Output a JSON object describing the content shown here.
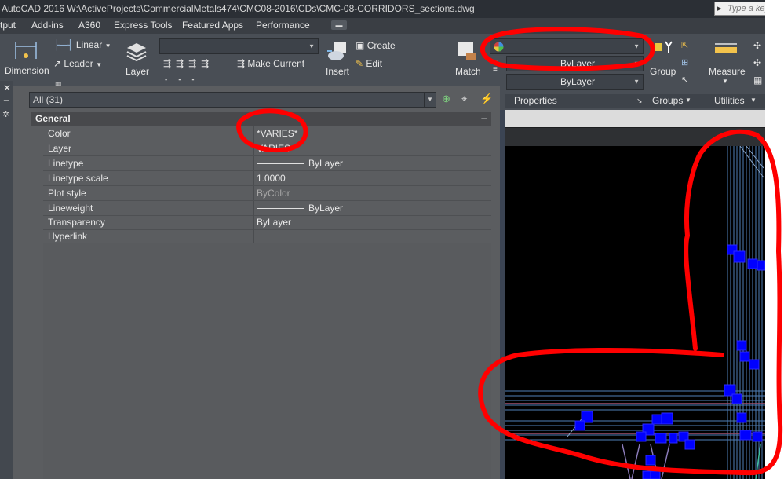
{
  "title_bar": {
    "text": "AutoCAD 2016    W:\\ActiveProjects\\CommercialMetals474\\CMC08-2016\\CDs\\CMC-08-CORRIDORS_sections.dwg",
    "search_placeholder": "Type a keyw"
  },
  "tabs": [
    "tput",
    "Add-ins",
    "A360",
    "Express Tools",
    "Featured Apps",
    "Performance"
  ],
  "ribbon": {
    "dimension": "Dimension",
    "linear": "Linear",
    "leader": "Leader",
    "layer": "Layer",
    "make_current": "Make Current",
    "insert": "Insert",
    "create": "Create",
    "edit": "Edit",
    "match": "Match",
    "bylayer_1": "ByLayer",
    "bylayer_2": "ByLayer",
    "group": "Group",
    "measure": "Measure",
    "properties": "Properties",
    "groups": "Groups",
    "utilities": "Utilities"
  },
  "palette": {
    "selection": "All (31)",
    "section": "General",
    "collapse": "–",
    "rows": [
      {
        "label": "Color",
        "value": "*VARIES*"
      },
      {
        "label": "Layer",
        "value": "VARIES"
      },
      {
        "label": "Linetype",
        "value": "ByLayer"
      },
      {
        "label": "Linetype scale",
        "value": "1.0000"
      },
      {
        "label": "Plot style",
        "value": "ByColor"
      },
      {
        "label": "Lineweight",
        "value": "ByLayer"
      },
      {
        "label": "Transparency",
        "value": "ByLayer"
      },
      {
        "label": "Hyperlink",
        "value": ""
      }
    ]
  },
  "colors": {
    "markup": "#ff0000",
    "grip": "#0000ff",
    "selected_line": "#3a5bd8",
    "background": "#000000"
  }
}
